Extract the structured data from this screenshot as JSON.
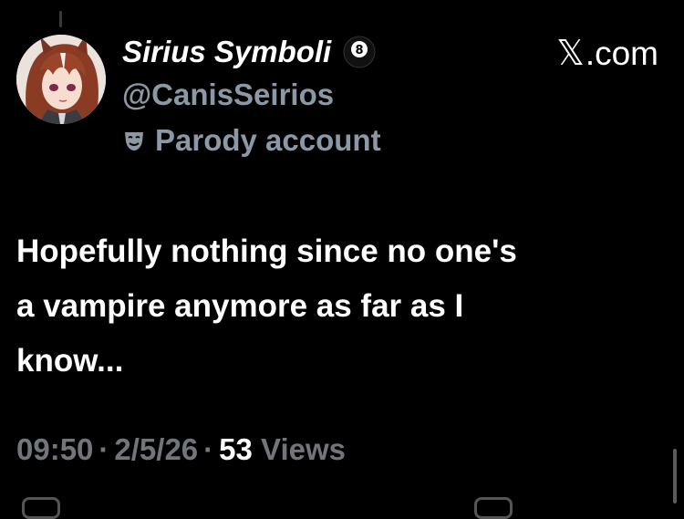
{
  "author": {
    "display_name": "Sirius Symboli",
    "badge_icon": "eight-ball-icon",
    "handle": "@CanisSeirios",
    "parody_icon": "theater-mask-icon",
    "parody_label": "Parody account"
  },
  "site": {
    "logo_glyph": "𝕏",
    "suffix": ".com"
  },
  "tweet": {
    "text": "Hopefully nothing since no one's\na vampire anymore as far as I\nknow..."
  },
  "meta": {
    "time": "09:50",
    "separator": "·",
    "date": "2/5/26",
    "views_count": "53",
    "views_label": "Views"
  },
  "colors": {
    "background": "#000000",
    "primary_text": "#ffffff",
    "secondary_text": "#8b98a5"
  }
}
